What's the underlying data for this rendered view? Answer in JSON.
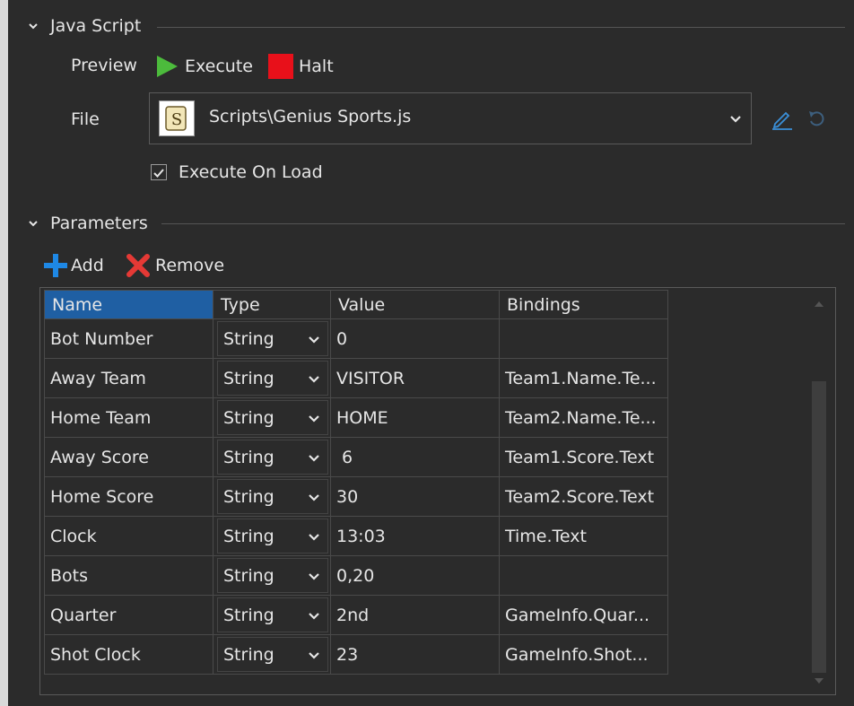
{
  "js_section": {
    "title": "Java Script",
    "preview_label": "Preview",
    "execute_label": "Execute",
    "halt_label": "Halt",
    "file_label": "File",
    "file_value": "Scripts\\Genius Sports.js",
    "execute_on_load_label": "Execute On Load",
    "execute_on_load_checked": true
  },
  "params_section": {
    "title": "Parameters",
    "add_label": "Add",
    "remove_label": "Remove"
  },
  "table": {
    "columns": [
      "Name",
      "Type",
      "Value",
      "Bindings"
    ],
    "rows": [
      {
        "name": "Bot Number",
        "type": "String",
        "value": "0",
        "binding": ""
      },
      {
        "name": "Away Team",
        "type": "String",
        "value": "VISITOR",
        "binding": "Team1.Name.Te..."
      },
      {
        "name": "Home Team",
        "type": "String",
        "value": "HOME",
        "binding": "Team2.Name.Te..."
      },
      {
        "name": "Away Score",
        "type": "String",
        "value": " 6",
        "binding": "Team1.Score.Text"
      },
      {
        "name": "Home Score",
        "type": "String",
        "value": "30",
        "binding": "Team2.Score.Text"
      },
      {
        "name": "Clock",
        "type": "String",
        "value": "13:03",
        "binding": "Time.Text"
      },
      {
        "name": "Bots",
        "type": "String",
        "value": "0,20",
        "binding": ""
      },
      {
        "name": "Quarter",
        "type": "String",
        "value": "2nd",
        "binding": "GameInfo.Quar..."
      },
      {
        "name": "Shot Clock",
        "type": "String",
        "value": "23",
        "binding": "GameInfo.Shot..."
      }
    ]
  },
  "colors": {
    "background": "#2b2b2b",
    "execute_green": "#4cbb3c",
    "halt_red": "#e8101a",
    "add_blue": "#1e88e5",
    "remove_red": "#e53935",
    "header_selected": "#1f5fa3",
    "edit_icon_blue": "#3a8fd8"
  },
  "icons": {
    "execute": "play-icon",
    "halt": "stop-icon",
    "add": "plus-icon",
    "remove": "x-icon",
    "file": "script-scroll-icon",
    "edit": "pencil-icon",
    "reset": "undo-icon"
  }
}
